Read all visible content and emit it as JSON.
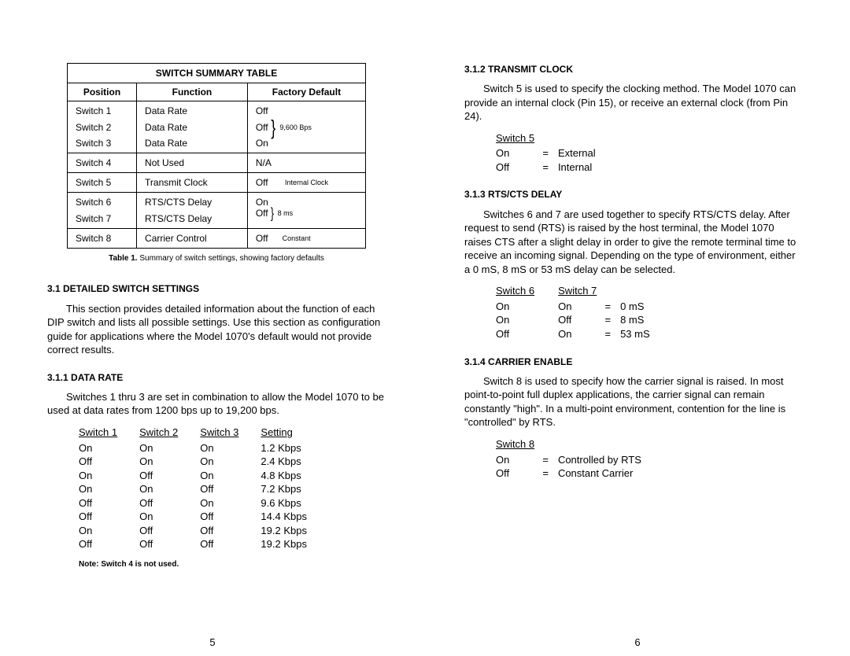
{
  "left": {
    "table": {
      "title": "SWITCH SUMMARY TABLE",
      "headers": [
        "Position",
        "Function",
        "Factory Default"
      ],
      "rows": [
        {
          "pos": "Switch 1",
          "fn": "Data Rate",
          "fd": "Off"
        },
        {
          "pos": "Switch 2",
          "fn": "Data Rate",
          "fd": "Off",
          "note": "9,600 Bps"
        },
        {
          "pos": "Switch 3",
          "fn": "Data Rate",
          "fd": "On"
        },
        {
          "pos": "Switch 4",
          "fn": "Not Used",
          "fd": "N/A"
        },
        {
          "pos": "Switch 5",
          "fn": "Transmit Clock",
          "fd": "Off",
          "note": "Internal  Clock"
        },
        {
          "pos": "Switch 6",
          "fn": "RTS/CTS Delay",
          "fd": "On"
        },
        {
          "pos": "Switch 7",
          "fn": "RTS/CTS Delay",
          "fd": "Off",
          "note": "8 ms"
        },
        {
          "pos": "Switch 8",
          "fn": "Carrier Control",
          "fd": "Off",
          "note": "Constant"
        }
      ]
    },
    "caption_bold": "Table 1.",
    "caption_rest": "  Summary of switch settings, showing factory defaults",
    "sec31": "3.1  DETAILED SWITCH SETTINGS",
    "sec31_body": "This section provides detailed information about the function of each DIP switch and lists all possible settings.  Use this section as configuration guide for applications where the Model 1070's default would not provide correct results.",
    "sec311": "3.1.1  DATA RATE",
    "sec311_body": "Switches 1 thru 3 are set in combination to allow the Model 1070 to be used at data rates from 1200 bps up to 19,200 bps.",
    "data_table": {
      "headers": [
        "Switch 1",
        "Switch 2",
        "Switch 3",
        "Setting"
      ],
      "rows": [
        [
          "On",
          "On",
          "On",
          "1.2 Kbps"
        ],
        [
          "Off",
          "On",
          "On",
          "2.4 Kbps"
        ],
        [
          "On",
          "Off",
          "On",
          "4.8 Kbps"
        ],
        [
          "On",
          "On",
          "Off",
          "7.2 Kbps"
        ],
        [
          "Off",
          "Off",
          "On",
          "9.6 Kbps"
        ],
        [
          "Off",
          "On",
          "Off",
          "14.4 Kbps"
        ],
        [
          "On",
          "Off",
          "Off",
          "19.2 Kbps"
        ],
        [
          "Off",
          "Off",
          "Off",
          "19.2 Kbps"
        ]
      ]
    },
    "note": "Note:  Switch 4 is not used.",
    "pagenum": "5"
  },
  "right": {
    "sec312": "3.1.2  TRANSMIT CLOCK",
    "sec312_body": "Switch 5 is used to specify the clocking method.  The Model 1070 can provide an internal clock (Pin 15), or receive an external clock (from Pin 24).",
    "sw5": {
      "header": "Switch 5",
      "rows": [
        [
          "On",
          "=",
          "External"
        ],
        [
          "Off",
          "=",
          "Internal"
        ]
      ]
    },
    "sec313": "3.1.3  RTS/CTS DELAY",
    "sec313_body": "Switches 6 and 7 are used together to specify RTS/CTS delay.  After request to send (RTS) is raised by the host terminal, the Model 1070 raises CTS after a slight delay in order to give the remote terminal time to receive an incoming signal.  Depending on the type of environment, either a 0 mS, 8 mS or 53 mS delay can be selected.",
    "sw67": {
      "headers": [
        "Switch 6",
        "Switch 7"
      ],
      "rows": [
        [
          "On",
          "On",
          "=",
          "0 mS"
        ],
        [
          "On",
          "Off",
          "=",
          "8 mS"
        ],
        [
          "Off",
          "On",
          "=",
          "53 mS"
        ]
      ]
    },
    "sec314": "3.1.4  CARRIER ENABLE",
    "sec314_body": "Switch 8 is used to specify how the carrier signal is raised.  In most point-to-point full duplex applications, the carrier signal can remain constantly \"high\".  In a multi-point environment, contention for the line is \"controlled\" by RTS.",
    "sw8": {
      "header": "Switch 8",
      "rows": [
        [
          "On",
          "=",
          "Controlled by RTS"
        ],
        [
          "Off",
          "=",
          "Constant Carrier"
        ]
      ]
    },
    "pagenum": "6"
  }
}
